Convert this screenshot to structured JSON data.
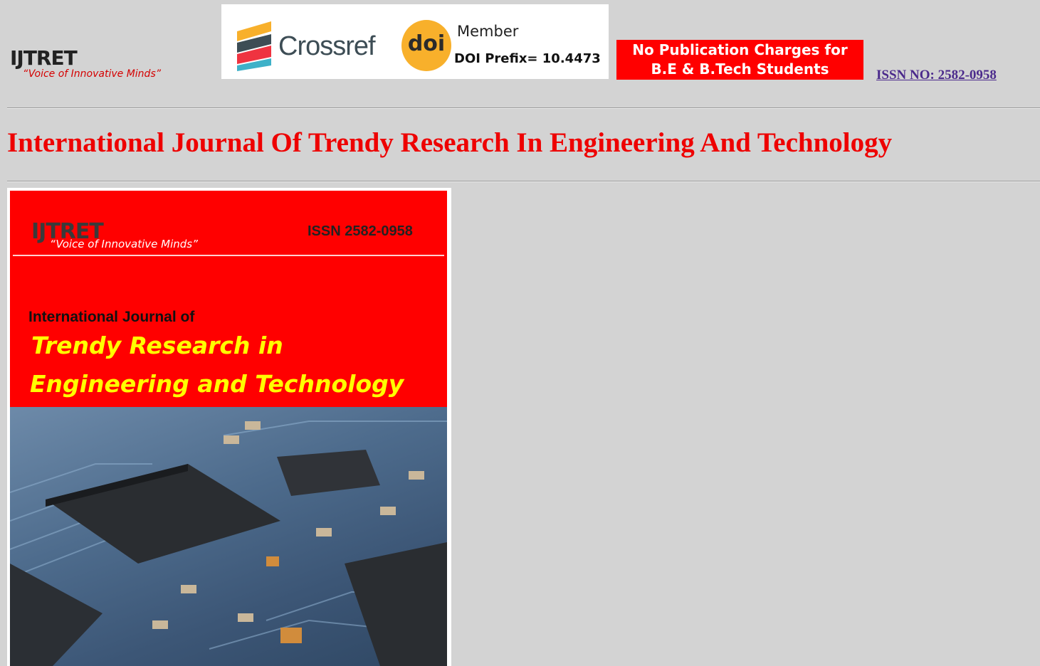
{
  "header": {
    "logo": {
      "mark": "IJTRET",
      "tagline": "“Voice of Innovative Minds”"
    },
    "crossref": {
      "brand": "Crossref",
      "doi_badge": "doi",
      "member_label": "Member",
      "doi_prefix": "DOI Prefix= 10.4473"
    },
    "notice": {
      "line1": "No Publication Charges for",
      "line2": "B.E & B.Tech Students"
    },
    "issn_link": "ISSN NO: 2582-0958"
  },
  "main": {
    "title": "International Journal Of Trendy Research In Engineering And Technology",
    "cover": {
      "logo_mark": "IJTRET",
      "logo_tagline": "“Voice of Innovative Minds”",
      "issn": "ISSN 2582-0958",
      "subtitle": "International Journal of",
      "title_line1": "Trendy Research in",
      "title_line2": "Engineering and Technology"
    }
  },
  "colors": {
    "page_bg": "#d3d3d3",
    "title_red": "#ee0000",
    "notice_red": "#ff0000",
    "link_purple": "#4b2a8c",
    "cover_yellow": "#ffff00",
    "doi_orange": "#f8b02b"
  },
  "icons": [
    "crossref-logo-icon",
    "doi-badge-icon",
    "circuit-board-image"
  ]
}
